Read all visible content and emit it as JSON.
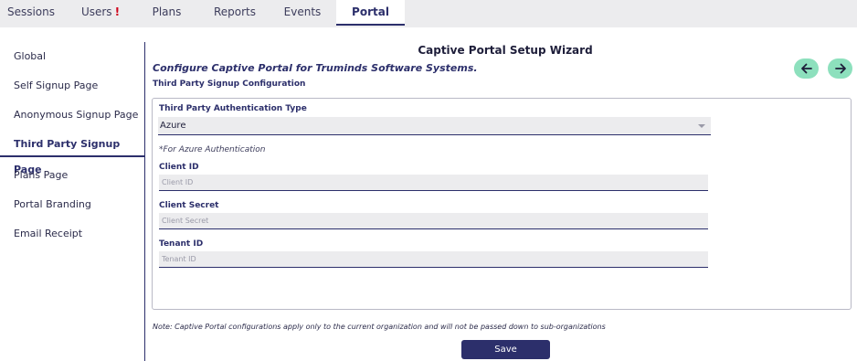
{
  "topnav": {
    "tabs": [
      {
        "label": "Sessions"
      },
      {
        "label": "Users"
      },
      {
        "label": "Plans"
      },
      {
        "label": "Reports"
      },
      {
        "label": "Events"
      },
      {
        "label": "Portal"
      }
    ],
    "users_alert": "!",
    "active_tab": "Portal"
  },
  "sidebar": {
    "items": [
      {
        "label": "Global"
      },
      {
        "label": "Self Signup Page"
      },
      {
        "label": "Anonymous Signup Page"
      },
      {
        "label": "Third Party Signup Page"
      },
      {
        "label": "Plans Page"
      },
      {
        "label": "Portal Branding"
      },
      {
        "label": "Email Receipt"
      }
    ],
    "active_item": "Third Party Signup Page"
  },
  "main": {
    "title": "Captive Portal Setup Wizard",
    "subtitle": "Configure Captive Portal for Truminds Software Systems.",
    "section_label": "Third Party Signup Configuration",
    "auth_type_label": "Third Party Authentication Type",
    "auth_type_value": "Azure",
    "azure_note": "*For Azure Authentication",
    "client_id_label": "Client ID",
    "client_id_placeholder": "Client ID",
    "client_secret_label": "Client Secret",
    "client_secret_placeholder": "Client Secret",
    "tenant_id_label": "Tenant ID",
    "tenant_id_placeholder": "Tenant ID",
    "footer_note": "Note: Captive Portal configurations apply only to the current organization and will not be passed down to sub-organizations",
    "save_label": "Save"
  },
  "colors": {
    "accent": "#2c2f6b",
    "nav_button": "#8de0bd",
    "alert": "#d0021b"
  },
  "icons": {
    "back": "arrow-left-icon",
    "forward": "arrow-right-icon"
  }
}
